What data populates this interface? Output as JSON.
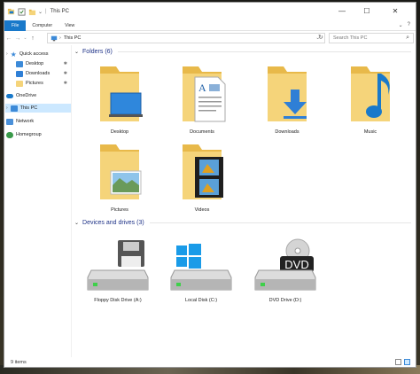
{
  "window": {
    "title": "This PC",
    "controls": [
      "—",
      "☐",
      "✕"
    ]
  },
  "ribbon": {
    "tabs": [
      "File",
      "Computer",
      "View"
    ],
    "right": [
      "⌄",
      "?"
    ]
  },
  "address": {
    "back": "←",
    "forward": "→",
    "recent": "⌄",
    "up": "↑",
    "separator": "›",
    "path": "This PC",
    "dropdown": "⌄",
    "refresh": "↻",
    "search_placeholder": "Search This PC",
    "search_icon": "⌕"
  },
  "sidebar": {
    "quick_access": "Quick access",
    "quick_items": [
      "Desktop",
      "Downloads",
      "Pictures"
    ],
    "pin_glyph": "✱",
    "onedrive": "OneDrive",
    "this_pc": "This PC",
    "network": "Network",
    "homegroup": "Homegroup",
    "expand_glyph": "›"
  },
  "main": {
    "folders_header": "Folders (6)",
    "drives_header": "Devices and drives (3)",
    "chevron": "⌄",
    "folders": [
      {
        "label": "Desktop",
        "icon": "desktop-folder-icon"
      },
      {
        "label": "Documents",
        "icon": "documents-folder-icon"
      },
      {
        "label": "Downloads",
        "icon": "downloads-folder-icon"
      },
      {
        "label": "Music",
        "icon": "music-folder-icon"
      },
      {
        "label": "Pictures",
        "icon": "pictures-folder-icon"
      },
      {
        "label": "Videos",
        "icon": "videos-folder-icon"
      }
    ],
    "drives": [
      {
        "label": "Floppy Disk Drive (A:)",
        "icon": "floppy-drive-icon"
      },
      {
        "label": "Local Disk (C:)",
        "icon": "local-disk-icon"
      },
      {
        "label": "DVD Drive (D:)",
        "icon": "dvd-drive-icon",
        "disc_text": "DVD"
      }
    ]
  },
  "status": {
    "items": "9 items"
  },
  "colors": {
    "accent": "#1979ca",
    "folder": "#f5d47a",
    "folder_dark": "#e8b94a",
    "link": "#1e3287",
    "selection": "#cce8ff"
  }
}
